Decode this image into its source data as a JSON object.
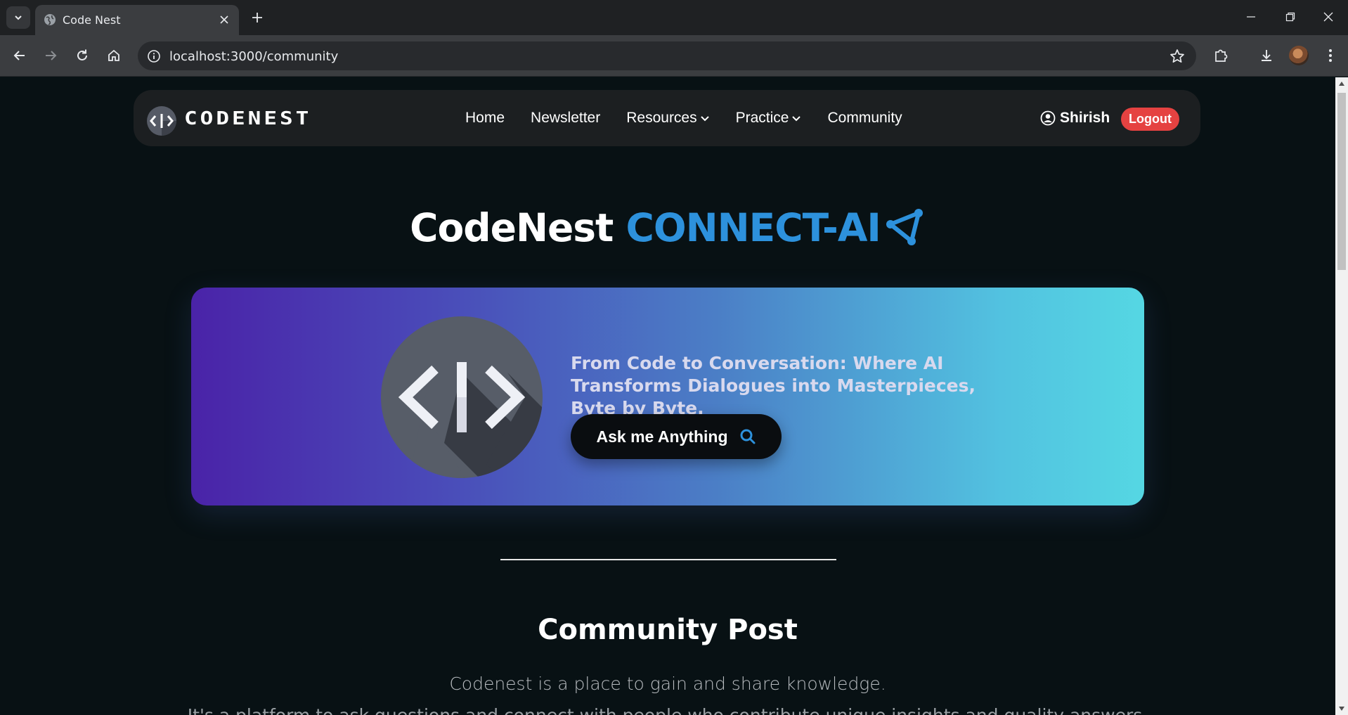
{
  "browser": {
    "tab_title": "Code Nest",
    "url": "localhost:3000/community",
    "icons": {
      "tab_list": "chevron-down-icon",
      "favicon": "globe-icon",
      "close": "close-icon",
      "new_tab": "plus-icon",
      "back": "arrow-left-icon",
      "forward": "arrow-right-icon",
      "reload": "reload-icon",
      "home": "home-icon",
      "site_info": "info-icon",
      "bookmark": "star-icon",
      "extensions": "puzzle-icon",
      "downloads": "download-icon",
      "menu": "kebab-menu-icon"
    }
  },
  "navbar": {
    "logo_text": "CODENEST",
    "links": {
      "home": "Home",
      "newsletter": "Newsletter",
      "resources": "Resources",
      "practice": "Practice",
      "community": "Community"
    },
    "user_name": "Shirish",
    "logout_label": "Logout"
  },
  "hero": {
    "title_main": "CodeNest",
    "title_accent": "CONNECT-AI",
    "accent_color": "#2d91dc"
  },
  "banner": {
    "tagline": "From Code to Conversation: Where AI Transforms Dialogues into Masterpieces, Byte by Byte.",
    "ask_button_label": "Ask me Anything"
  },
  "community": {
    "title": "Community Post",
    "subtitle": "Codenest is a place to gain and share knowledge.",
    "subtitle_2": "It's a platform to ask questions and connect with people who contribute unique insights and quality answers."
  },
  "colors": {
    "page_bg": "#081114",
    "navbar_bg": "#1c1f21",
    "logout_bg": "#e54241"
  }
}
